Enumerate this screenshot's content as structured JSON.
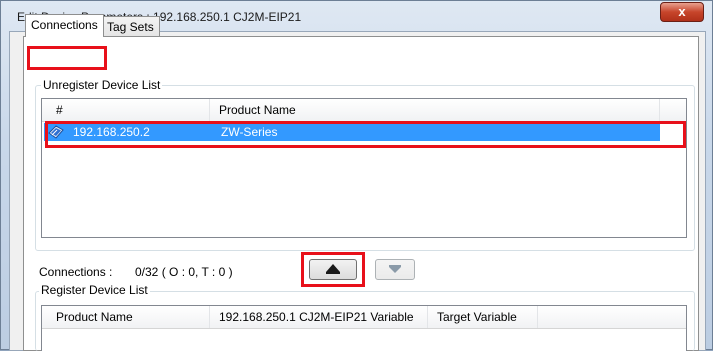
{
  "window": {
    "title": "Edit Device Parameters : 192.168.250.1 CJ2M-EIP21",
    "close_symbol": "x"
  },
  "tabs": [
    {
      "label": "Connections",
      "active": true
    },
    {
      "label": "Tag Sets",
      "active": false
    }
  ],
  "unregister": {
    "group_label": "Unregister Device List",
    "columns": [
      "#",
      "Product Name"
    ],
    "rows": [
      {
        "address": "192.168.250.2",
        "product": "ZW-Series",
        "selected": true,
        "icon": "device-icon"
      }
    ]
  },
  "connections": {
    "label": "Connections :",
    "value": "0/32 ( O : 0, T : 0 )"
  },
  "buttons": {
    "register_icon": "register-arrow-icon",
    "unregister_icon": "unregister-arrow-icon"
  },
  "register": {
    "group_label": "Register Device List",
    "columns": [
      "Product Name",
      "192.168.250.1 CJ2M-EIP21 Variable",
      "Target Variable"
    ]
  },
  "colors": {
    "selection": "#3399ff",
    "highlight": "#e8101a",
    "close_button": "#c7452b"
  }
}
